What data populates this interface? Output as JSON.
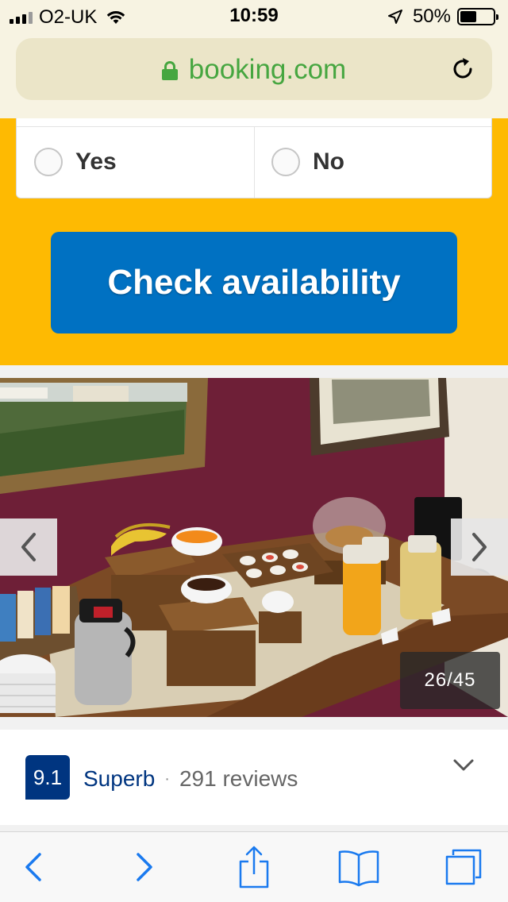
{
  "status_bar": {
    "carrier": "O2-UK",
    "time": "10:59",
    "battery_text": "50%",
    "battery_level": 0.5
  },
  "browser": {
    "url": "booking.com",
    "icons": {
      "lock": "lock-icon",
      "reload": "reload-icon"
    }
  },
  "form": {
    "options": [
      {
        "label": "Yes",
        "selected": false
      },
      {
        "label": "No",
        "selected": false
      }
    ],
    "cta_label": "Check availability"
  },
  "gallery": {
    "counter": "26/45",
    "current": 26,
    "total": 45
  },
  "review": {
    "score": "9.1",
    "word": "Superb",
    "separator": "·",
    "count": "291 reviews"
  },
  "colors": {
    "booking_blue": "#003580",
    "cta_blue": "#0071c2",
    "form_yellow": "#feba02",
    "secure_green": "#46a640"
  },
  "toolbar": {
    "icons": [
      "back-icon",
      "forward-icon",
      "share-icon",
      "bookmarks-icon",
      "tabs-icon"
    ]
  }
}
